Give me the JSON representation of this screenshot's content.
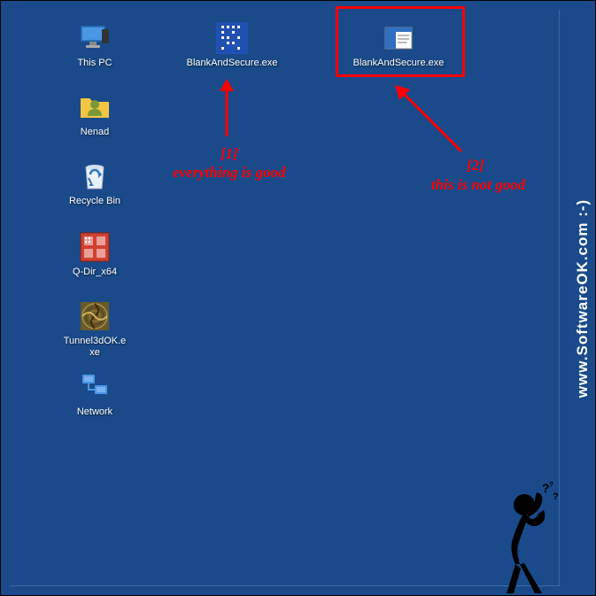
{
  "desktop_icons": {
    "this_pc": {
      "label": "This PC"
    },
    "nenad": {
      "label": "Nenad"
    },
    "recycle_bin": {
      "label": "Recycle Bin"
    },
    "q_dir": {
      "label": "Q-Dir_x64"
    },
    "tunnel3d": {
      "label": "Tunnel3dOK.exe"
    },
    "network": {
      "label": "Network"
    },
    "blank_secure_1": {
      "label": "BlankAndSecure.exe"
    },
    "blank_secure_2": {
      "label": "BlankAndSecure.exe"
    }
  },
  "annotations": {
    "num1": "[1]",
    "text1": "everything is good",
    "num2": "[2]",
    "text2": "this is not good"
  },
  "watermark": "www.SoftwareOK.com :-)",
  "colors": {
    "desktop_bg": "#1a4a8a",
    "annotation": "#ff0000"
  }
}
